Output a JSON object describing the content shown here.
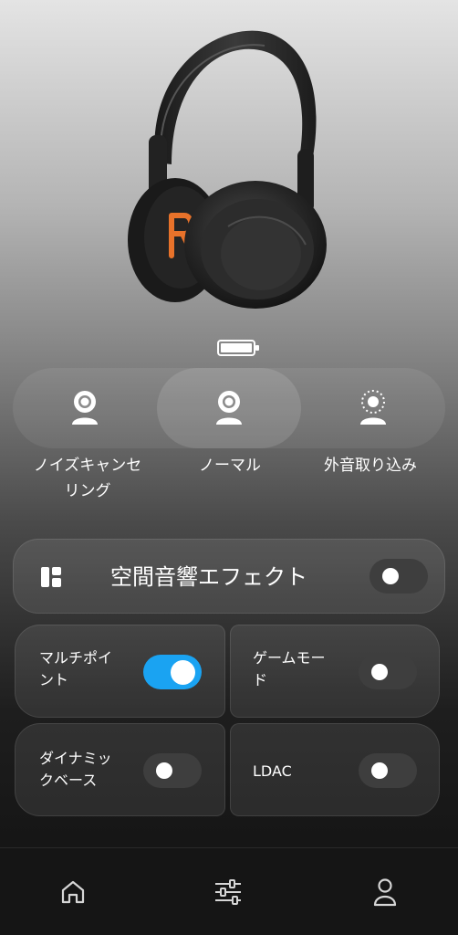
{
  "device": {
    "image": "headphones-image",
    "battery_icon": "battery-icon"
  },
  "anc_modes": [
    {
      "label": "ノイズキャンセ\nリング",
      "icon": "noise-cancel-icon",
      "selected": false
    },
    {
      "label": "ノーマル",
      "icon": "normal-mode-icon",
      "selected": true
    },
    {
      "label": "外音取り込み",
      "icon": "ambient-sound-icon",
      "selected": false
    }
  ],
  "spatial": {
    "label": "空間音響エフェクト",
    "icon": "spatial-audio-icon",
    "enabled": false
  },
  "toggles": [
    {
      "label": "マルチポイ\nント",
      "enabled": true
    },
    {
      "label": "ゲームモー\nド",
      "enabled": false
    },
    {
      "label": "ダイナミッ\nクベース",
      "enabled": false
    },
    {
      "label": "LDAC",
      "enabled": false
    }
  ],
  "nav": [
    {
      "icon": "home-icon"
    },
    {
      "icon": "equalizer-icon"
    },
    {
      "icon": "profile-icon"
    }
  ],
  "colors": {
    "accent": "#1aa3f2",
    "orange_logo": "#e8722a"
  }
}
